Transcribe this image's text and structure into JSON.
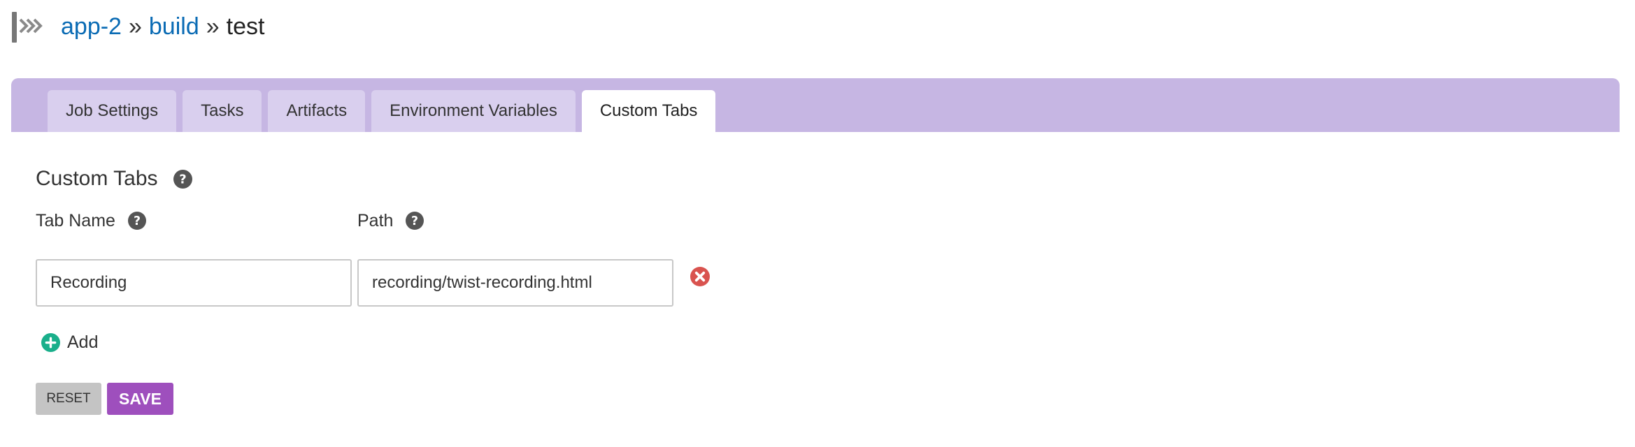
{
  "header": {
    "icon": "pipeline-arrows-icon",
    "breadcrumb": {
      "pipeline": "app-2",
      "separator_1": "»",
      "stage": "build",
      "separator_2": "»",
      "job": "test"
    }
  },
  "tabs": [
    {
      "label": "Job Settings",
      "active": false
    },
    {
      "label": "Tasks",
      "active": false
    },
    {
      "label": "Artifacts",
      "active": false
    },
    {
      "label": "Environment Variables",
      "active": false
    },
    {
      "label": "Custom Tabs",
      "active": true
    }
  ],
  "custom_tabs": {
    "title": "Custom Tabs",
    "tab_name_label": "Tab Name",
    "path_label": "Path",
    "rows": [
      {
        "tab_name": "Recording",
        "path": "recording/twist-recording.html"
      }
    ],
    "add_label": "Add"
  },
  "actions": {
    "reset_label": "RESET",
    "save_label": "SAVE"
  },
  "colors": {
    "link": "#0a6bb4",
    "tab_bar": "#c6b6e3",
    "tab_inactive": "#d9cfee",
    "save_button": "#9e4fbd",
    "reset_button": "#c4c4c4",
    "remove_icon": "#d9534f",
    "add_icon": "#1aaf8b",
    "help_icon": "#555555"
  }
}
